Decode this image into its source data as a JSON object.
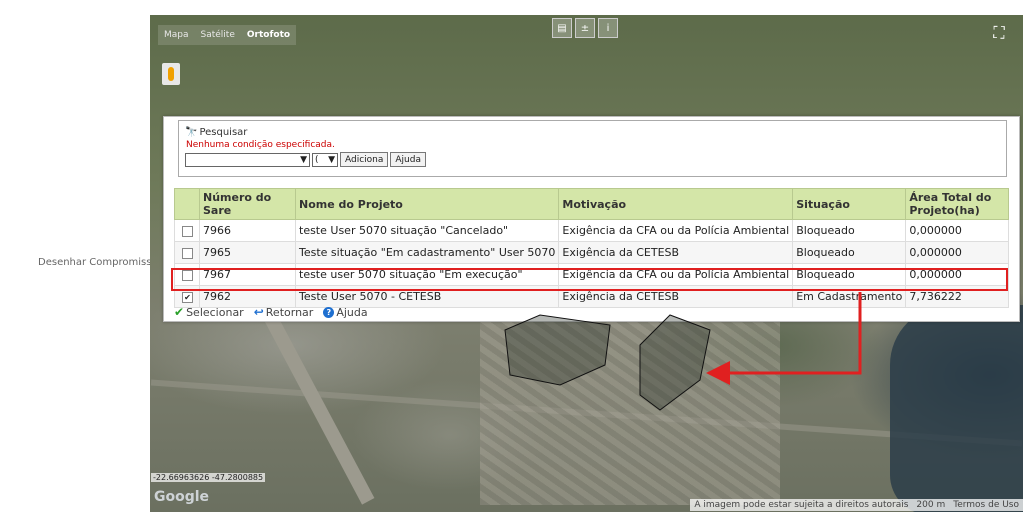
{
  "left_label": "Desenhar Compromisso:",
  "map": {
    "type_buttons": [
      "Mapa",
      "Satélite",
      "Ortofoto"
    ],
    "active_type": "Ortofoto",
    "coords": "-22.66963626 -47.2800885",
    "google_logo": "Google",
    "attribution": [
      "A imagem pode estar sujeita a direitos autorais",
      "200 m",
      "Termos de Uso"
    ]
  },
  "search": {
    "title": "Pesquisar",
    "error": "Nenhuma condição especificada.",
    "paren": "(",
    "add_label": "Adiciona",
    "help_label": "Ajuda"
  },
  "table": {
    "headers": [
      "Número do Sare",
      "Nome do Projeto",
      "Motivação",
      "Situação",
      "Área Total do Projeto(ha)"
    ],
    "rows": [
      {
        "checked": false,
        "numero": "7966",
        "nome": "teste User 5070 situação \"Cancelado\"",
        "motivacao": "Exigência da CFA ou da Polícia Ambiental",
        "situacao": "Bloqueado",
        "area": "0,000000"
      },
      {
        "checked": false,
        "numero": "7965",
        "nome": "Teste situação \"Em cadastramento\" User 5070",
        "motivacao": "Exigência da CETESB",
        "situacao": "Bloqueado",
        "area": "0,000000"
      },
      {
        "checked": false,
        "numero": "7967",
        "nome": "teste user 5070 situação \"Em execução\"",
        "motivacao": "Exigência da CFA ou da Polícia Ambiental",
        "situacao": "Bloqueado",
        "area": "0,000000"
      },
      {
        "checked": true,
        "numero": "7962",
        "nome": "Teste User 5070 - CETESB",
        "motivacao": "Exigência da CETESB",
        "situacao": "Em Cadastramento",
        "area": "7,736222"
      }
    ]
  },
  "footer": {
    "select_label": "Selecionar",
    "return_label": "Retornar",
    "help_label": "Ajuda"
  },
  "colors": {
    "header_bg": "#d4e6a8",
    "highlight": "#e02020",
    "error_text": "#cc0000"
  }
}
